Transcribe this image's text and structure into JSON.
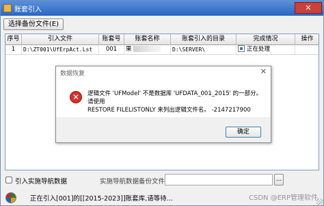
{
  "window": {
    "title": "账套引入",
    "close_glyph": "✕"
  },
  "toolbar": {
    "select_backup_label": "选择备份文件(E)"
  },
  "table": {
    "columns": [
      "序号",
      "引入文件",
      "账套号",
      "账套名称",
      "账套引入的目录",
      "完成情况",
      "操作"
    ],
    "rows": [
      {
        "index": "1",
        "file": "D:\\ZT001\\UfErpAct.Lst",
        "account_no": "001",
        "account_name": "果",
        "target_dir": "D:\\SERVER\\",
        "status": "正在处理",
        "action": ""
      }
    ]
  },
  "dialog": {
    "title": "数据恢复",
    "close_glyph": "✕",
    "message_line1": "逻辑文件 'UFModel' 不是数据库 'UFDATA_001_2015' 的一部分。请使用",
    "message_line2": "RESTORE FILELISTONLY 来列出逻辑文件名。 -2147217900",
    "ok_label": "确定",
    "icon_glyph": "✕"
  },
  "bottom": {
    "checkbox_label": "引入实施导航数据",
    "path_label": "实施导航数据备份文件",
    "path_value": "",
    "browse_label": "..."
  },
  "status": {
    "text": "正在引入[001]的[[2015-2023]]账套库,请等待...",
    "watermark": "CSDN @ERP管理软件"
  }
}
